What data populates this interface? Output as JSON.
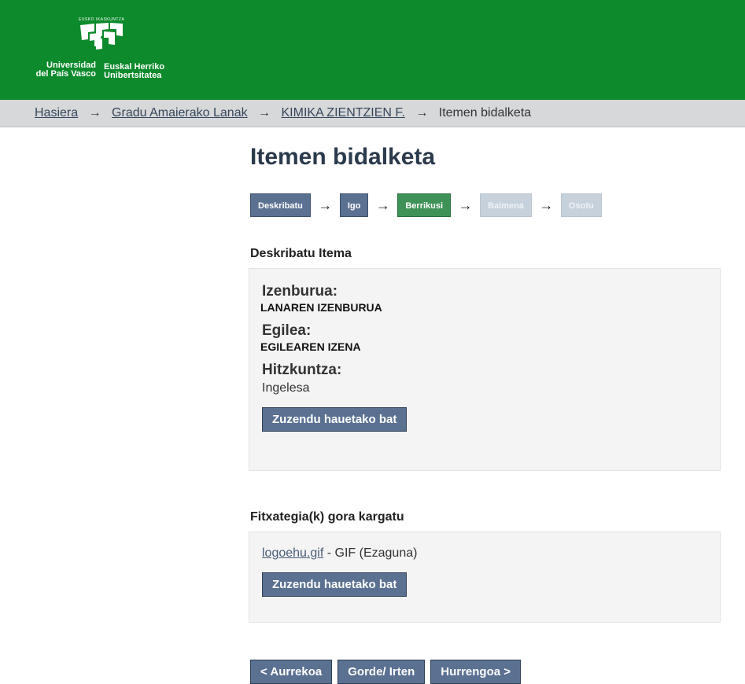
{
  "header": {
    "logo_caption": "EUSKO IKASKUNTZA",
    "logo_text_es_line1": "Universidad",
    "logo_text_es_line2": "del País Vasco",
    "logo_text_eu_line1": "Euskal Herriko",
    "logo_text_eu_line2": "Unibertsitatea",
    "background_color": "#0c8a2c"
  },
  "breadcrumb": {
    "items": [
      {
        "label": "Hasiera"
      },
      {
        "label": "Gradu Amaierako Lanak"
      },
      {
        "label": "KIMIKA ZIENTZIEN F."
      }
    ],
    "current": "Itemen bidalketa",
    "separator": "→"
  },
  "page_title": "Itemen bidalketa",
  "steps": [
    {
      "label": "Deskribatu",
      "state": "done"
    },
    {
      "label": "Igo",
      "state": "done"
    },
    {
      "label": "Berrikusi",
      "state": "current"
    },
    {
      "label": "Baimena",
      "state": "todo"
    },
    {
      "label": "Osotu",
      "state": "todo"
    }
  ],
  "describe_section": {
    "heading": "Deskribatu Itema",
    "fields": [
      {
        "label": "Izenburua:",
        "value": "LANAREN IZENBURUA"
      },
      {
        "label": "Egilea:",
        "value": "EGILEAREN IZENA"
      },
      {
        "label": "Hitzkuntza:",
        "value": "Ingelesa"
      }
    ],
    "edit_button": "Zuzendu hauetako bat"
  },
  "upload_section": {
    "heading": "Fitxategia(k) gora kargatu",
    "file_name": "logoehu.gif",
    "file_info": " - GIF (Ezaguna)",
    "edit_button": "Zuzendu hauetako bat"
  },
  "buttons": {
    "previous": "< Aurrekoa",
    "save_exit": "Gorde/ Irten",
    "next": "Hurrengoa >"
  }
}
